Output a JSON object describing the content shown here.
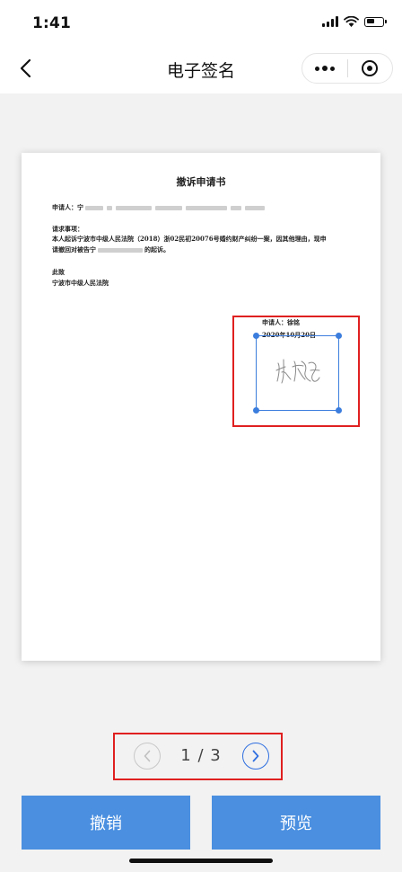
{
  "status_bar": {
    "time": "1:41"
  },
  "nav": {
    "title": "电子签名",
    "back_icon": "chevron-left-icon",
    "more_icon": "more-dots-icon",
    "close_icon": "miniprogram-close-icon"
  },
  "document": {
    "title": "撤诉申请书",
    "applicant_label": "申请人：宁",
    "request_label": "请求事项：",
    "body_line1": "本人起诉宁波市中级人民法院（2018）浙02民初20076号婚约财产纠纷一案，因其他理由，现申",
    "body_line2_prefix": "请撤回对被告宁",
    "body_line2_suffix": "的起诉。",
    "closing": "此致",
    "court": "宁波市中级人民法院",
    "sign_name": "申请人：徐铭",
    "sign_date": "2020年10月20日"
  },
  "pager": {
    "current": "1",
    "separator": "/",
    "total": "3",
    "display": "1 / 3"
  },
  "buttons": {
    "cancel": "撤销",
    "preview": "预览"
  },
  "colors": {
    "accent_blue": "#4a8fe0",
    "selection_blue": "#3b7ddd",
    "highlight_red": "#e02020"
  }
}
